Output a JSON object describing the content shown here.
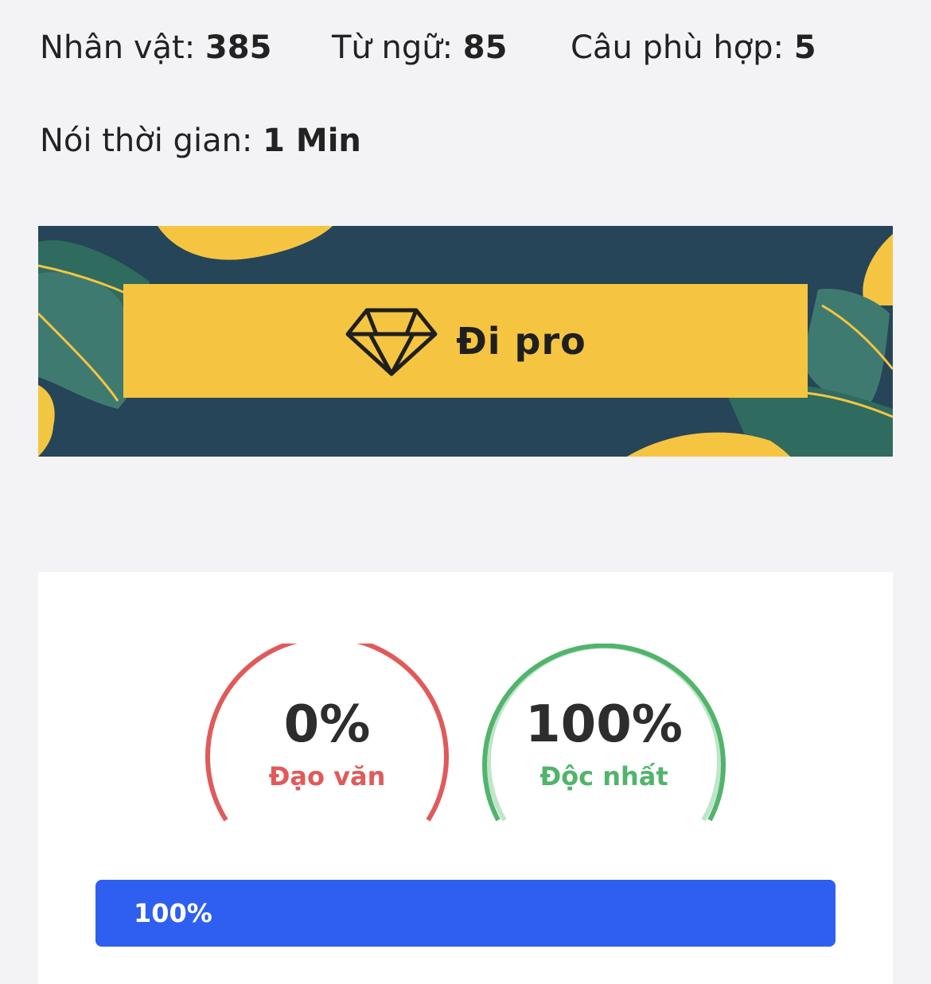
{
  "stats": {
    "characters": {
      "label": "Nhân vật: ",
      "value": "385"
    },
    "words": {
      "label": "Từ ngữ: ",
      "value": "85"
    },
    "sentences": {
      "label": "Câu phù hợp: ",
      "value": "5"
    },
    "speaking_time": {
      "label": "Nói thời gian: ",
      "value": "1 Min"
    }
  },
  "banner": {
    "button_label": "Đi pro",
    "icon": "diamond-icon",
    "colors": {
      "background": "#264558",
      "button": "#f5c542",
      "leaf": "#2f6b5e",
      "accent": "#f5c542"
    }
  },
  "results": {
    "plagiarism": {
      "percent_text": "0%",
      "label": "Đạo văn",
      "value": 0,
      "color": "#e05a5a"
    },
    "unique": {
      "percent_text": "100%",
      "label": "Độc nhất",
      "value": 100,
      "color": "#52b46c"
    },
    "progress": {
      "text": "100%",
      "value": 1.0,
      "color": "#2f5ff0"
    }
  }
}
